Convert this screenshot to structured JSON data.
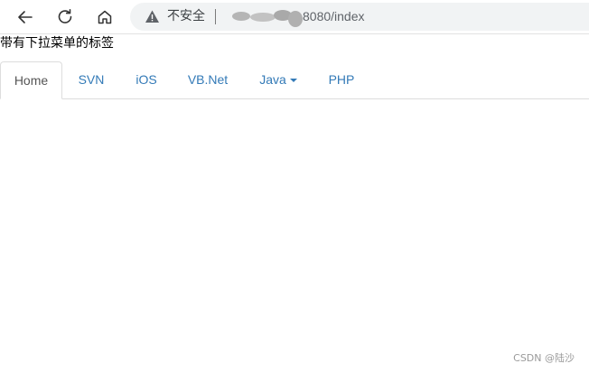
{
  "browser": {
    "security_label": "不安全",
    "url_visible": "8080/index"
  },
  "page": {
    "heading": "带有下拉菜单的标签"
  },
  "tabs": [
    {
      "label": "Home",
      "active": true
    },
    {
      "label": "SVN",
      "active": false
    },
    {
      "label": "iOS",
      "active": false
    },
    {
      "label": "VB.Net",
      "active": false
    },
    {
      "label": "Java",
      "active": false,
      "dropdown": true
    },
    {
      "label": "PHP",
      "active": false
    }
  ],
  "watermark": "CSDN @陆沙",
  "colors": {
    "link": "#337ab7",
    "active_tab_text": "#555555",
    "tab_border": "#dddddd"
  },
  "icons": {
    "back": "arrow-left-icon",
    "reload": "reload-icon",
    "home": "home-icon",
    "security": "warning-triangle-icon"
  }
}
